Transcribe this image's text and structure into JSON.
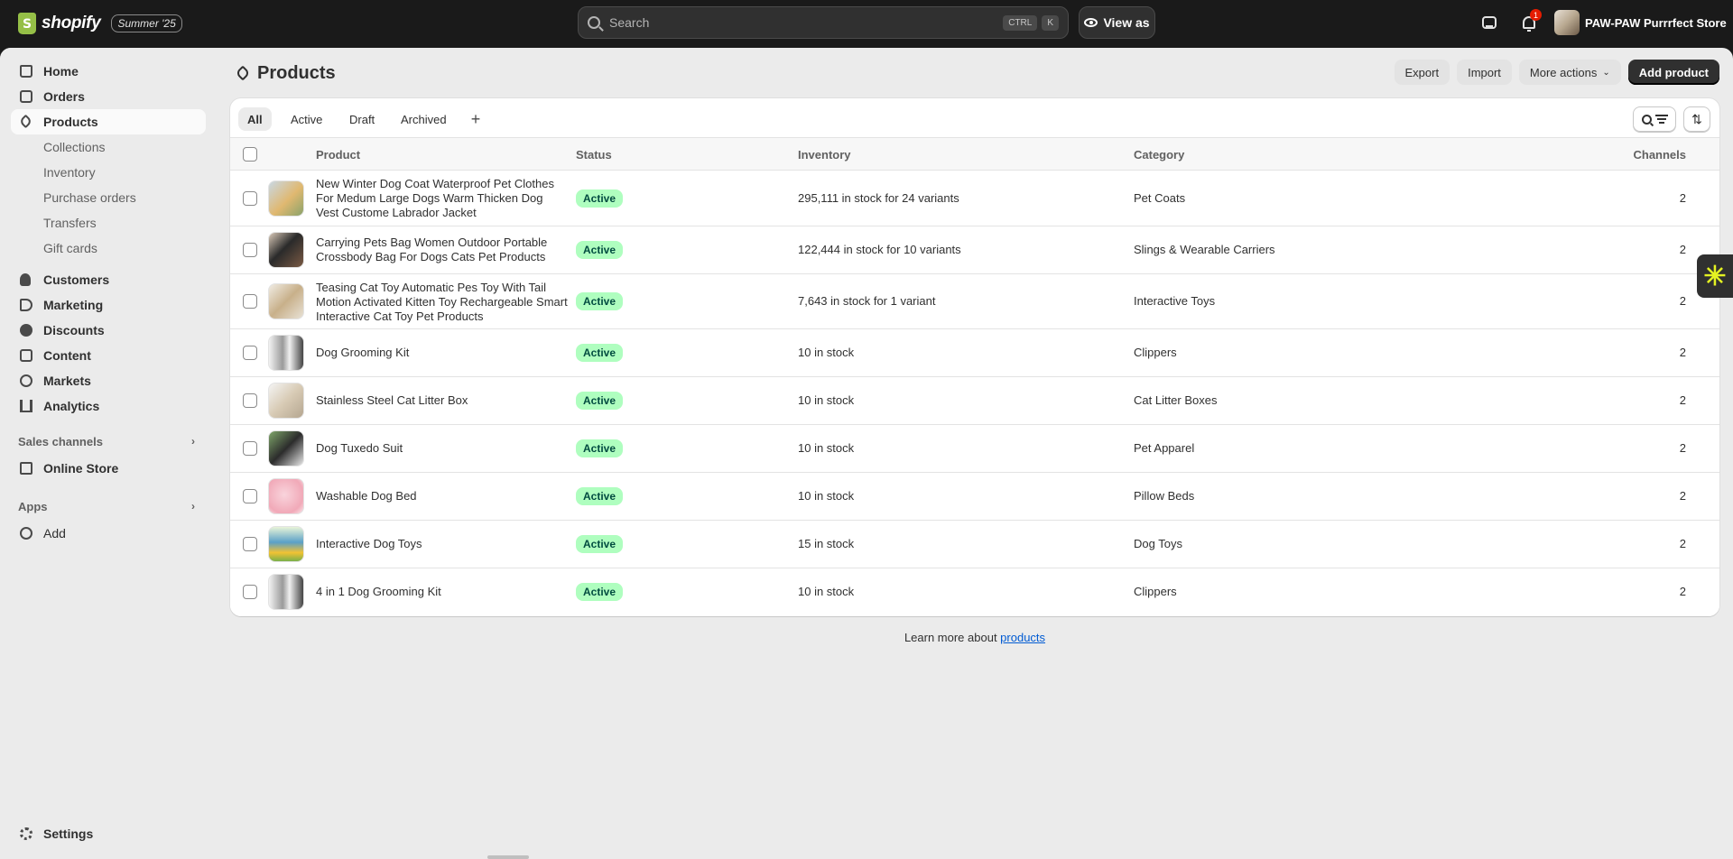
{
  "topbar": {
    "brand": "shopify",
    "badge": "Summer '25",
    "search_placeholder": "Search",
    "kbd1": "CTRL",
    "kbd2": "K",
    "view_as": "View as",
    "notifications": "1",
    "store_name": "PAW-PAW Purrrfect Store"
  },
  "sidebar": {
    "home": "Home",
    "orders": "Orders",
    "products": "Products",
    "collections": "Collections",
    "inventory": "Inventory",
    "purchase_orders": "Purchase orders",
    "transfers": "Transfers",
    "gift_cards": "Gift cards",
    "customers": "Customers",
    "marketing": "Marketing",
    "discounts": "Discounts",
    "content": "Content",
    "markets": "Markets",
    "analytics": "Analytics",
    "sales_channels": "Sales channels",
    "online_store": "Online Store",
    "apps": "Apps",
    "add": "Add",
    "settings": "Settings"
  },
  "page": {
    "title": "Products",
    "export": "Export",
    "import": "Import",
    "more_actions": "More actions",
    "add_product": "Add product"
  },
  "tabs": [
    "All",
    "Active",
    "Draft",
    "Archived"
  ],
  "table": {
    "headers": {
      "product": "Product",
      "status": "Status",
      "inventory": "Inventory",
      "category": "Category",
      "channels": "Channels"
    },
    "rows": [
      {
        "name": "New Winter Dog Coat Waterproof Pet Clothes For Medum Large Dogs Warm Thicken Dog Vest Custome Labrador Jacket",
        "status": "Active",
        "inventory": "295,111 in stock for 24 variants",
        "category": "Pet Coats",
        "channels": "2"
      },
      {
        "name": "Carrying Pets Bag Women Outdoor Portable Crossbody Bag For Dogs Cats Pet Products",
        "status": "Active",
        "inventory": "122,444 in stock for 10 variants",
        "category": "Slings & Wearable Carriers",
        "channels": "2"
      },
      {
        "name": "Teasing Cat Toy Automatic Pes Toy With Tail Motion Activated Kitten Toy Rechargeable Smart Interactive Cat Toy Pet Products",
        "status": "Active",
        "inventory": "7,643 in stock for 1 variant",
        "category": "Interactive Toys",
        "channels": "2"
      },
      {
        "name": "Dog Grooming Kit",
        "status": "Active",
        "inventory": "10 in stock",
        "category": "Clippers",
        "channels": "2"
      },
      {
        "name": "Stainless Steel Cat Litter Box",
        "status": "Active",
        "inventory": "10 in stock",
        "category": "Cat Litter Boxes",
        "channels": "2"
      },
      {
        "name": "Dog Tuxedo Suit",
        "status": "Active",
        "inventory": "10 in stock",
        "category": "Pet Apparel",
        "channels": "2"
      },
      {
        "name": "Washable Dog Bed",
        "status": "Active",
        "inventory": "10 in stock",
        "category": "Pillow Beds",
        "channels": "2"
      },
      {
        "name": "Interactive Dog Toys",
        "status": "Active",
        "inventory": "15 in stock",
        "category": "Dog Toys",
        "channels": "2"
      },
      {
        "name": "4 in 1 Dog Grooming Kit",
        "status": "Active",
        "inventory": "10 in stock",
        "category": "Clippers",
        "channels": "2"
      }
    ]
  },
  "footer": {
    "learn_prefix": "Learn more about ",
    "learn_link": "products"
  },
  "colors": {
    "topbar": "#1a1a1a",
    "background": "#ebebeb",
    "active_badge": "#affebf",
    "link": "#005bd3",
    "primary_button": "#303030"
  }
}
